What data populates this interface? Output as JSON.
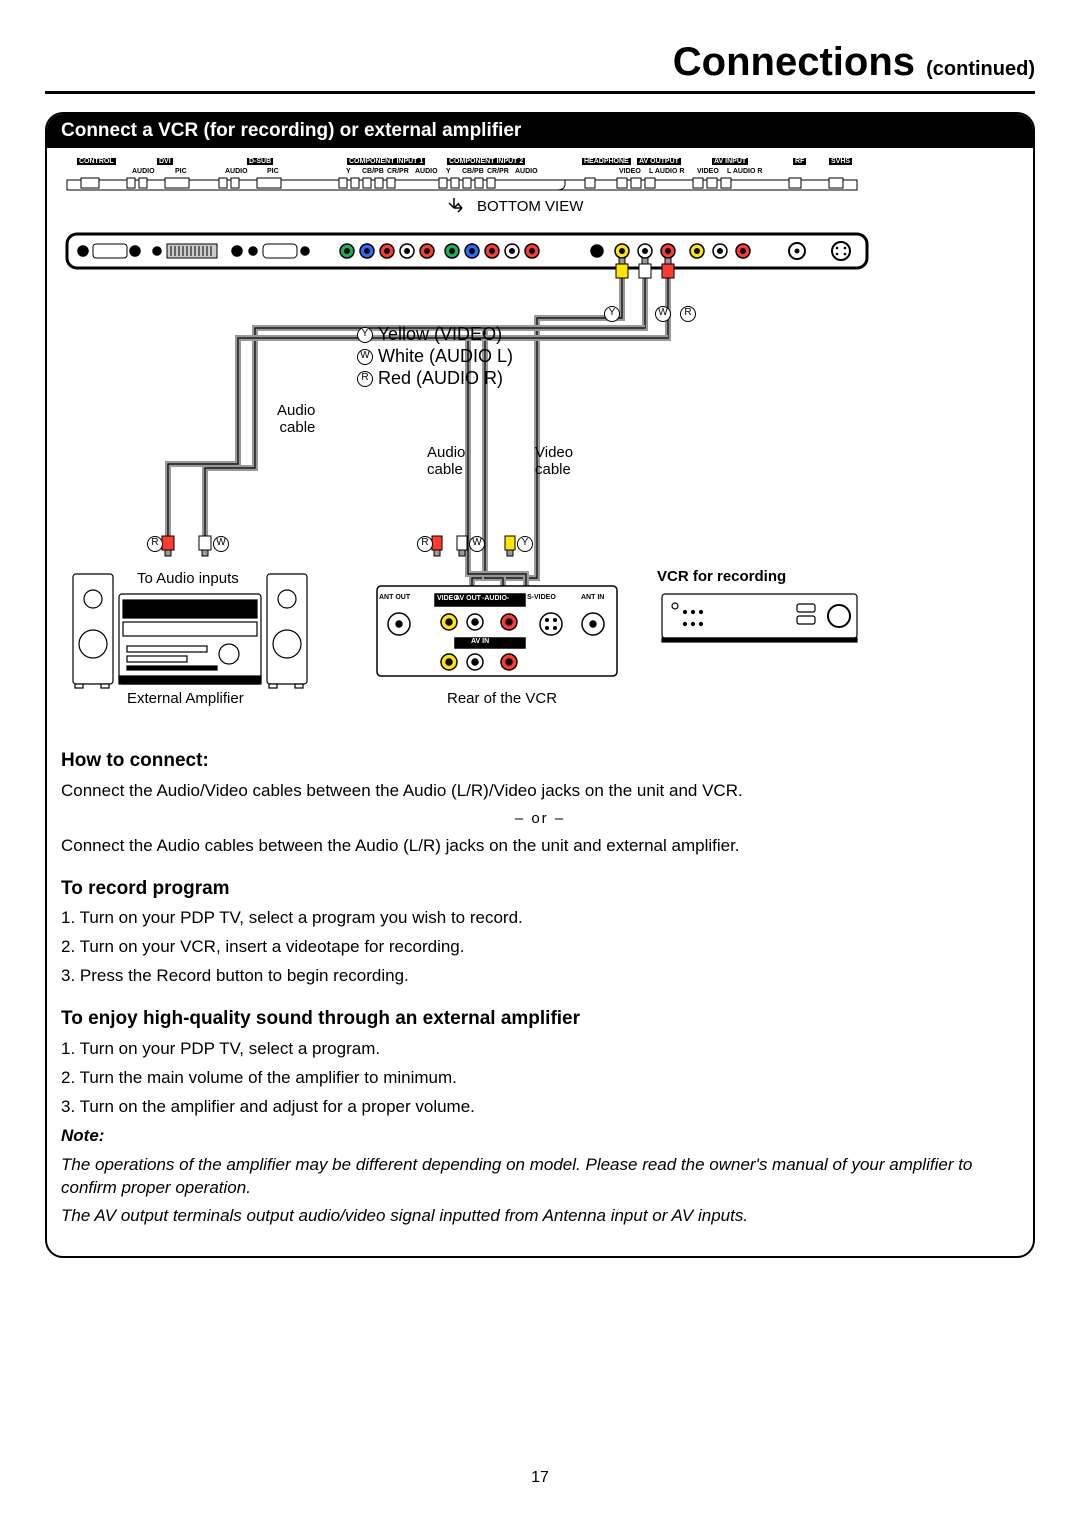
{
  "header": {
    "title": "Connections",
    "subtitle": "(continued)"
  },
  "panel": {
    "title": "Connect a VCR (for recording) or external amplifier"
  },
  "ports": {
    "groups": [
      {
        "name": "CONTROL",
        "labels": [],
        "inv": true
      },
      {
        "name": "DVI",
        "labels": [
          "AUDIO",
          "PIC"
        ],
        "inv": true
      },
      {
        "name": "D-SUB",
        "labels": [
          "AUDIO",
          "PIC"
        ],
        "inv": true
      },
      {
        "name": "COMPONENT INPUT 1",
        "labels": [
          "Y",
          "CB/PB",
          "CR/PR",
          "AUDIO"
        ],
        "inv": true
      },
      {
        "name": "COMPONENT INPUT 2",
        "labels": [
          "Y",
          "CB/PB",
          "CR/PR",
          "AUDIO"
        ],
        "inv": true
      },
      {
        "name": "HEADPHONE",
        "labels": [],
        "inv": true
      },
      {
        "name": "AV OUTPUT",
        "labels": [
          "VIDEO",
          "L AUDIO R"
        ],
        "inv": true
      },
      {
        "name": "AV INPUT",
        "labels": [
          "VIDEO",
          "L AUDIO R"
        ],
        "inv": true
      },
      {
        "name": "RF",
        "labels": [],
        "inv": true
      },
      {
        "name": "SVHS",
        "labels": [],
        "inv": true
      }
    ],
    "bottom_view": "BOTTOM VIEW"
  },
  "legend": {
    "y": "Y",
    "w": "W",
    "r": "R",
    "yellow": "Yellow (VIDEO)",
    "white": "White (AUDIO L)",
    "red": "Red (AUDIO R)",
    "audio_cable": "Audio\ncable",
    "video_cable": "Video\ncable",
    "to_audio": "To Audio inputs",
    "ext_amp": "External Amplifier",
    "vcr": "VCR for recording",
    "rear_vcr": "Rear of the VCR",
    "ant_out": "ANT OUT",
    "ant_in": "ANT IN",
    "svideo": "S-VIDEO",
    "av_out": "AV  OUT",
    "av_in": "AV  IN",
    "vid": "VIDEO",
    "aud": "-AUDIO-",
    "l": "L"
  },
  "howto": {
    "title": "How to connect:",
    "line1": "Connect the Audio/Video cables between the Audio (L/R)/Video jacks on the unit and VCR.",
    "or": "– or –",
    "line2": "Connect the Audio cables between the Audio (L/R) jacks on the unit and external amplifier."
  },
  "record": {
    "title": "To record program",
    "s1": "1. Turn on your PDP TV, select a program you wish to record.",
    "s2": "2. Turn on your VCR, insert a videotape for recording.",
    "s3": "3. Press the Record button to begin recording."
  },
  "amp": {
    "title": "To enjoy high-quality sound through an external amplifier",
    "s1": "1. Turn on your PDP TV, select a program.",
    "s2": "2. Turn the main volume of the amplifier to minimum.",
    "s3": "3. Turn on the amplifier and adjust for a proper volume."
  },
  "note": {
    "title": "Note:",
    "body1": "The operations of the amplifier may be different depending on model. Please read the owner's manual of your amplifier to confirm proper operation.",
    "body2": "The AV output terminals output audio/video signal inputted from Antenna input or AV inputs."
  },
  "page_number": "17"
}
